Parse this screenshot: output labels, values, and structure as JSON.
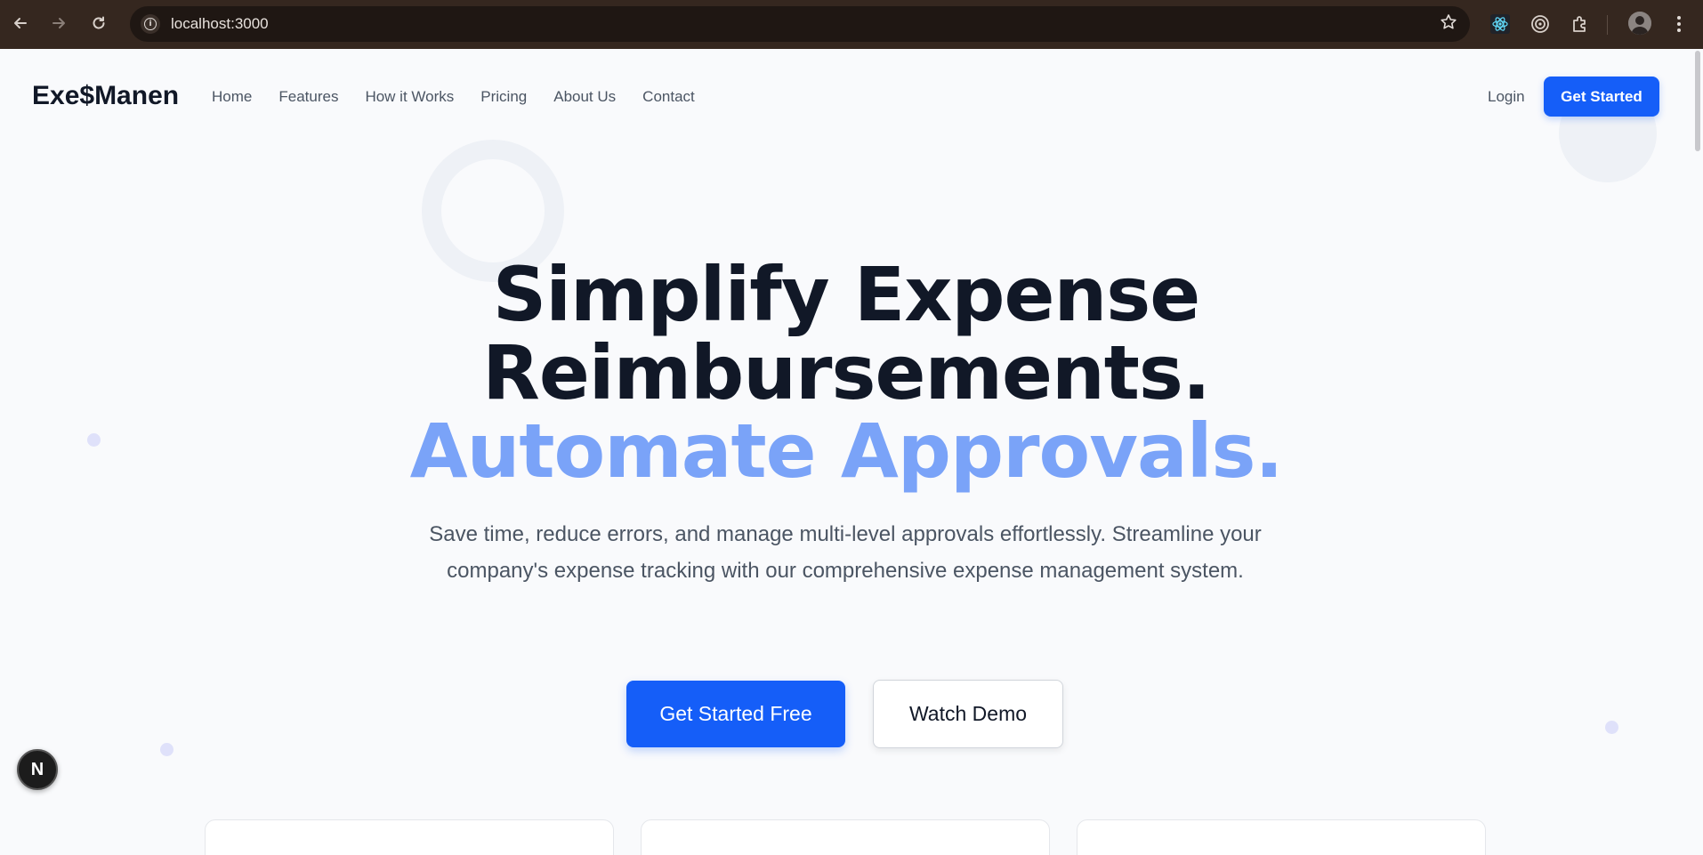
{
  "browser": {
    "url": "localhost:3000",
    "icons": [
      "back-icon",
      "forward-icon",
      "reload-icon",
      "info-icon",
      "star-icon",
      "react-devtools-icon",
      "target-icon",
      "extensions-icon",
      "profile-avatar",
      "menu-icon"
    ]
  },
  "header": {
    "brand": "Exe$Manen",
    "nav": [
      "Home",
      "Features",
      "How it Works",
      "Pricing",
      "About Us",
      "Contact"
    ],
    "login": "Login",
    "cta": "Get Started"
  },
  "hero": {
    "line1": "Simplify Expense",
    "line2": "Reimbursements.",
    "line3": "Automate Approvals.",
    "subtitle": "Save time, reduce errors, and manage multi-level approvals effortlessly. Streamline your company's expense tracking with our comprehensive expense management system.",
    "primary_button": "Get Started Free",
    "secondary_button": "Watch Demo"
  },
  "dev_badge": "N",
  "colors": {
    "primary": "#155ef8",
    "heading": "#111827",
    "accent_heading": "#7aa3f8",
    "body_text": "#4b5563",
    "chrome_bg": "#35271f"
  }
}
